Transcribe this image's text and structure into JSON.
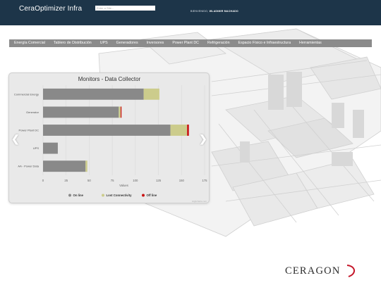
{
  "header": {
    "title": "CeraOptimizer Infra",
    "search_placeholder": "Enter a Site...",
    "welcome_prefix": "BIENVENIDO,",
    "user_name": "WLADIMIR MACHADO"
  },
  "nav": {
    "items": [
      "Energía Comercial",
      "Tablero de Distribución",
      "UPS",
      "Generadores",
      "Inversores",
      "Power Plant DC",
      "Refrigeración",
      "Espacio Físico e Infraestructura",
      "Herramientas"
    ]
  },
  "carousel": {
    "prev_glyph": "❮",
    "next_glyph": "❯"
  },
  "chart_data": {
    "type": "bar",
    "orientation": "horizontal",
    "stacked": true,
    "title": "Monitors - Data Collector",
    "xlabel": "Values",
    "ylabel": "",
    "xlim": [
      0,
      175
    ],
    "xticks": [
      0,
      25,
      50,
      75,
      100,
      125,
      150,
      175
    ],
    "categories": [
      "Commercial Energy",
      "Generator",
      "Power Plant DC",
      "UPS",
      "AA - Power Data"
    ],
    "series": [
      {
        "name": "On line",
        "color": "#898989",
        "values": [
          109,
          82,
          138,
          16,
          46
        ]
      },
      {
        "name": "Lost Connectivity",
        "color": "#cccc8c",
        "values": [
          17,
          2,
          18,
          0,
          2
        ]
      },
      {
        "name": "Off line",
        "color": "#c91414",
        "values": [
          0,
          1,
          2,
          0,
          0
        ]
      }
    ],
    "legend_position": "bottom",
    "grid": true,
    "credits": "Highcharts.com"
  },
  "brand": {
    "logo_text": "CERAGON",
    "accent_color": "#c5182b"
  }
}
